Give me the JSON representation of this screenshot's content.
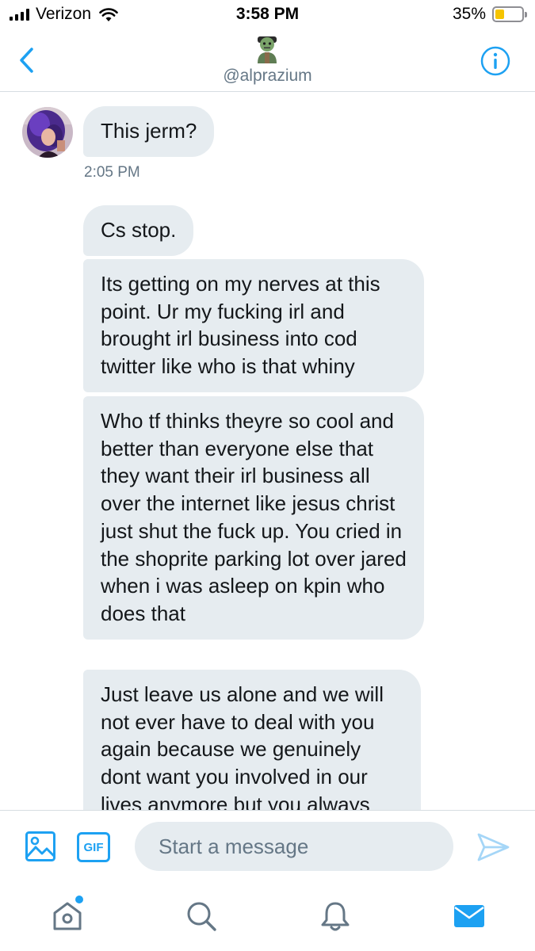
{
  "status_bar": {
    "carrier": "Verizon",
    "time": "3:58 PM",
    "battery_percent": "35%",
    "battery_level": 0.35,
    "battery_color": "#f5c400"
  },
  "header": {
    "handle": "@alprazium",
    "back_icon": "chevron-left-icon",
    "info_icon": "info-icon"
  },
  "messages": [
    {
      "text": "This jerm?"
    },
    {
      "text": "Cs stop."
    },
    {
      "text": "Its getting on my nerves at this point. Ur my fucking irl and brought irl business into cod twitter like who is that whiny"
    },
    {
      "text": "Who tf thinks theyre so cool and better than everyone else that they want their irl business all over the internet like jesus christ just shut the fuck up. You cried in the shoprite parking lot over jared when i was asleep on kpin who does that"
    },
    {
      "text": "Just leave us alone and we will not ever have to deal with you again because we genuinely dont want you involved in our lives anymore but you always"
    }
  ],
  "timestamp": "2:05 PM",
  "composer": {
    "gif_label": "GIF",
    "placeholder": "Start a message",
    "value": ""
  },
  "tab_bar": {
    "items": [
      "home-icon",
      "search-icon",
      "notifications-icon",
      "messages-icon"
    ],
    "active": "messages"
  },
  "colors": {
    "accent": "#1da1f2",
    "bubble": "#e6ecf0",
    "secondary_text": "#657786"
  }
}
